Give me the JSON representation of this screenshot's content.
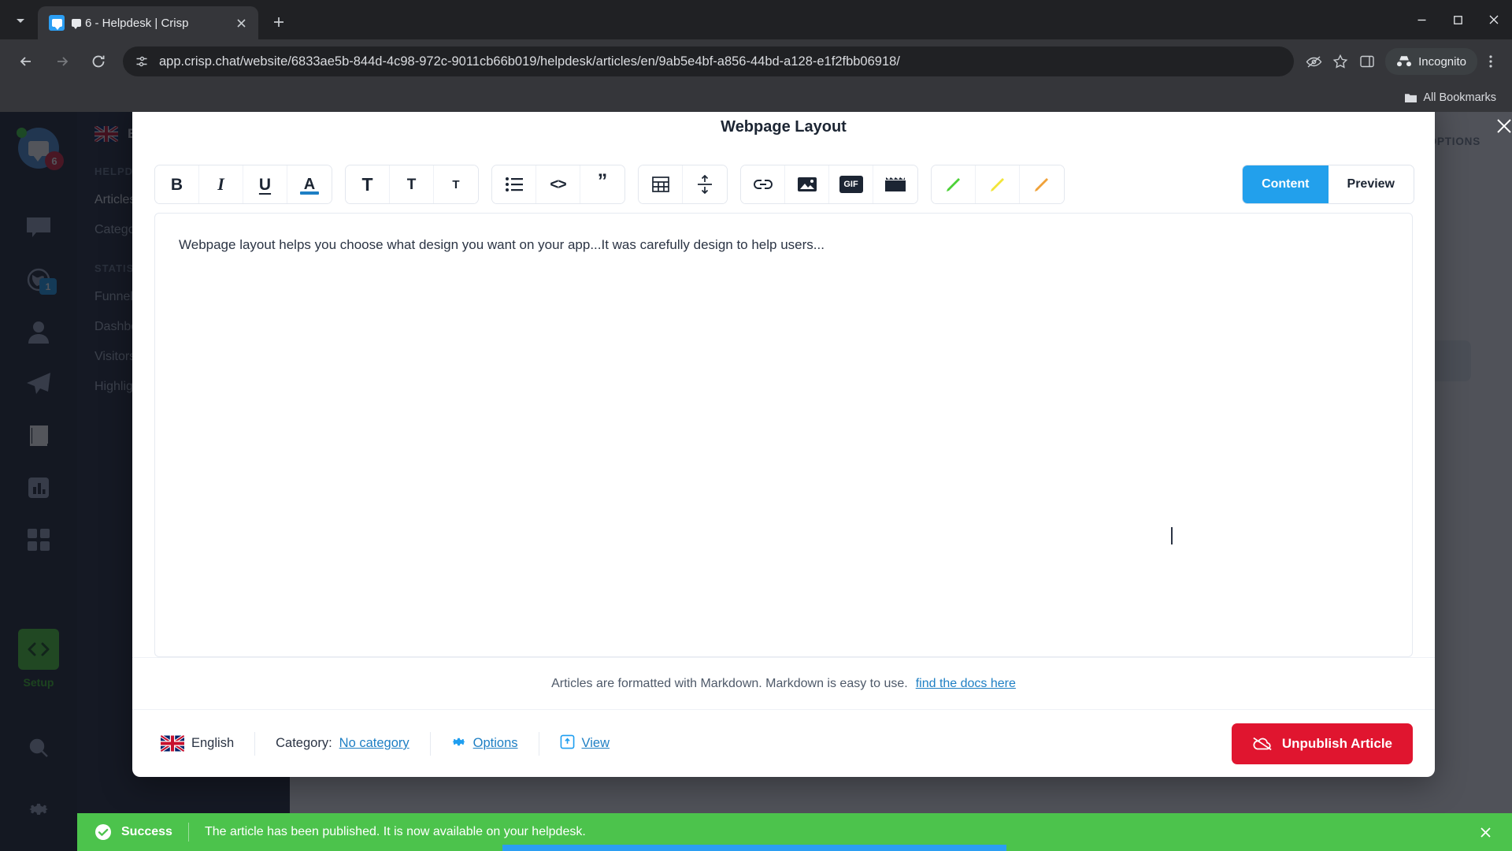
{
  "browser": {
    "tab": {
      "title": "6 - Helpdesk | Crisp",
      "favicon": "crisp-chat-icon"
    },
    "new_tab_label": "+",
    "url": "app.crisp.chat/website/6833ae5b-844d-4c98-972c-9011cb66b019/helpdesk/articles/en/9ab5e4bf-a856-44bd-a128-e1f2fbb06918/",
    "incognito_label": "Incognito",
    "bookmarks_label": "All Bookmarks"
  },
  "rail": {
    "avatar_badge": "6",
    "items": [
      {
        "name": "conversations",
        "icon": "chat-bubble-icon",
        "badge": null
      },
      {
        "name": "visitors",
        "icon": "globe-icon",
        "badge": "1"
      },
      {
        "name": "contacts",
        "icon": "person-icon",
        "badge": null
      },
      {
        "name": "campaigns",
        "icon": "paper-plane-icon",
        "badge": null
      },
      {
        "name": "helpdesk",
        "icon": "book-icon",
        "badge": null
      },
      {
        "name": "analytics",
        "icon": "bar-chart-icon",
        "badge": null
      },
      {
        "name": "plugins",
        "icon": "grid-icon",
        "badge": null
      }
    ],
    "setup_label": "Setup"
  },
  "background": {
    "language": "English",
    "sections": [
      {
        "label": "HELPDESK",
        "rows": [
          "Articles",
          "Categories"
        ]
      },
      {
        "label": "STATISTICS",
        "rows": [
          "Funnel",
          "Dashboard",
          "Visitors",
          "Highlights"
        ]
      }
    ],
    "header_right": "OPTIONS"
  },
  "modal": {
    "title": "Webpage Layout",
    "close_icon": "close-icon",
    "toolbar": {
      "groups": [
        {
          "buttons": [
            {
              "name": "bold-button",
              "glyph": "B",
              "style": "bold"
            },
            {
              "name": "italic-button",
              "glyph": "I",
              "style": "italic"
            },
            {
              "name": "underline-button",
              "glyph": "U",
              "style": "under"
            },
            {
              "name": "text-color-button",
              "glyph": "A",
              "style": "color"
            }
          ]
        },
        {
          "buttons": [
            {
              "name": "heading-1-button",
              "glyph": "T",
              "style": "t1"
            },
            {
              "name": "heading-2-button",
              "glyph": "T",
              "style": "t2"
            },
            {
              "name": "heading-3-button",
              "glyph": "T",
              "style": "t3"
            }
          ]
        },
        {
          "buttons": [
            {
              "name": "bullet-list-button",
              "glyph": "list",
              "style": "icon"
            },
            {
              "name": "code-button",
              "glyph": "<>",
              "style": "code"
            },
            {
              "name": "blockquote-button",
              "glyph": "”",
              "style": "quote"
            }
          ]
        },
        {
          "buttons": [
            {
              "name": "table-button",
              "glyph": "table",
              "style": "icon"
            },
            {
              "name": "divider-button",
              "glyph": "divider",
              "style": "icon"
            }
          ]
        },
        {
          "buttons": [
            {
              "name": "link-button",
              "glyph": "link",
              "style": "icon"
            },
            {
              "name": "image-button",
              "glyph": "image",
              "style": "icon"
            },
            {
              "name": "gif-button",
              "glyph": "GIF",
              "style": "chip"
            },
            {
              "name": "video-button",
              "glyph": "video",
              "style": "icon"
            }
          ]
        },
        {
          "buttons": [
            {
              "name": "highlight-green-button",
              "glyph": "pen",
              "style": "pen",
              "color": "#4cd137"
            },
            {
              "name": "highlight-yellow-button",
              "glyph": "pen",
              "style": "pen",
              "color": "#f2e53a"
            },
            {
              "name": "highlight-orange-button",
              "glyph": "pen",
              "style": "pen",
              "color": "#f0a23a"
            }
          ]
        }
      ]
    },
    "view_toggle": {
      "content_label": "Content",
      "preview_label": "Preview",
      "active": "Content",
      "active_color": "#22a0ec"
    },
    "editor": {
      "body": "Webpage layout helps you choose what design you want on your app...It was carefully design to help users..."
    },
    "markdown_note": {
      "text": "Articles are formatted with Markdown. Markdown is easy to use.",
      "link_label": "find the docs here"
    },
    "footer": {
      "language_label": "English",
      "language_flag": "uk-flag-icon",
      "category_prefix": "Category:",
      "category_value": "No category",
      "options_label": "Options",
      "options_icon": "gear-icon",
      "view_label": "View",
      "view_icon": "external-link-icon",
      "unpublish_label": "Unpublish Article",
      "unpublish_icon": "cloud-off-icon",
      "unpublish_color": "#e0152f"
    }
  },
  "toast": {
    "status": "Success",
    "message": "The article has been published. It is now available on your helpdesk.",
    "icon": "check-circle-icon",
    "close_icon": "close-icon",
    "color": "#4cc34c"
  }
}
